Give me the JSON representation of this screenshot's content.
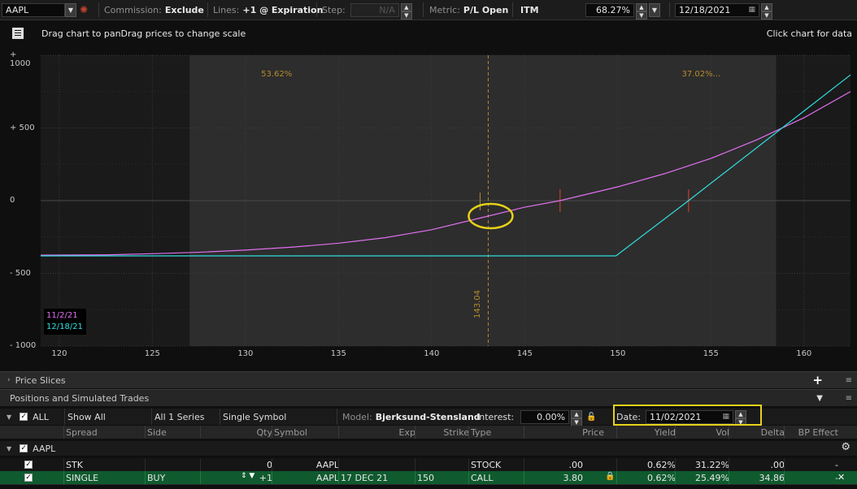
{
  "toolbar": {
    "symbol": "AAPL",
    "commission_label": "Commission:",
    "commission_value": "Exclude",
    "lines_label": "Lines:",
    "lines_value": "+1 @ Expiration",
    "step_label": "Step:",
    "step_value": "N/A",
    "metric_label": "Metric:",
    "metric_value": "P/L Open",
    "itm_label": "ITM",
    "pct_value": "68.27%",
    "date_value": "12/18/2021"
  },
  "chart_header": {
    "drag_text": "Drag chart to panDrag prices to change scale",
    "click_text": "Click chart for data"
  },
  "chart_data": {
    "type": "line",
    "xlim": [
      119,
      162.5
    ],
    "ylim": [
      -1000,
      1000
    ],
    "x_ticks": [
      120,
      125,
      130,
      135,
      140,
      145,
      150,
      155,
      160
    ],
    "y_ticks": [
      1000,
      500,
      0,
      -500,
      -1000
    ],
    "y_tick_labels": [
      "+ 1000",
      "+ 500",
      "0",
      "- 500",
      "- 1000"
    ],
    "series": [
      {
        "name": "11/2/21",
        "color": "#e070f0",
        "x": [
          119,
          122.5,
          125,
          127.5,
          130,
          132.5,
          135,
          137.5,
          140,
          142.5,
          145,
          146.9,
          150,
          152.5,
          155,
          157.5,
          160,
          162.5
        ],
        "y": [
          -375,
          -373,
          -365,
          -355,
          -340,
          -320,
          -293,
          -255,
          -200,
          -123,
          -45,
          0,
          95,
          185,
          290,
          420,
          570,
          750
        ]
      },
      {
        "name": "12/18/21",
        "color": "#30e0e0",
        "x": [
          119,
          127,
          135,
          143,
          149.9,
          153.8,
          162.5
        ],
        "y": [
          -380,
          -380,
          -380,
          -380,
          -380,
          0,
          865
        ]
      }
    ],
    "annotations": {
      "current_price": 143.04,
      "current_price_label": "143.04",
      "left_prob": "53.62%",
      "right_prob": "37.02%...",
      "shaded_range": [
        127,
        158.5
      ],
      "breakeven_marks": [
        146.9,
        153.8
      ]
    }
  },
  "legend": [
    "11/2/21",
    "12/18/21"
  ],
  "panels": {
    "price_slices": "Price Slices",
    "positions": "Positions and Simulated Trades"
  },
  "filter": {
    "all_label": "ALL",
    "show_all": "Show All",
    "series": "All 1 Series",
    "single_symbol": "Single Symbol",
    "model_label": "Model:",
    "model_value": "Bjerksund-Stensland",
    "interest_label": "Interest:",
    "interest_value": "0.00%",
    "date_label": "Date:",
    "date_value": "11/02/2021"
  },
  "columns": [
    "Spread",
    "Side",
    "Qty",
    "Symbol",
    "Exp",
    "Strike",
    "Type",
    "Price",
    "Yield",
    "Vol",
    "Delta",
    "BP Effect"
  ],
  "group": {
    "label": "AAPL"
  },
  "rows": [
    {
      "spread": "STK",
      "side": "",
      "qty": "0",
      "symbol": "AAPL",
      "exp": "",
      "strike": "",
      "type": "STOCK",
      "price": ".00",
      "yield": "0.62%",
      "vol": "31.22%",
      "delta": ".00",
      "bp": "-"
    },
    {
      "spread": "SINGLE",
      "side": "BUY",
      "qty": "+1",
      "symbol": "AAPL",
      "exp": "17 DEC 21",
      "strike": "150",
      "type": "CALL",
      "price": "3.80",
      "yield": "0.62%",
      "vol": "25.49%",
      "delta": "34.86",
      "bp": "-"
    }
  ]
}
